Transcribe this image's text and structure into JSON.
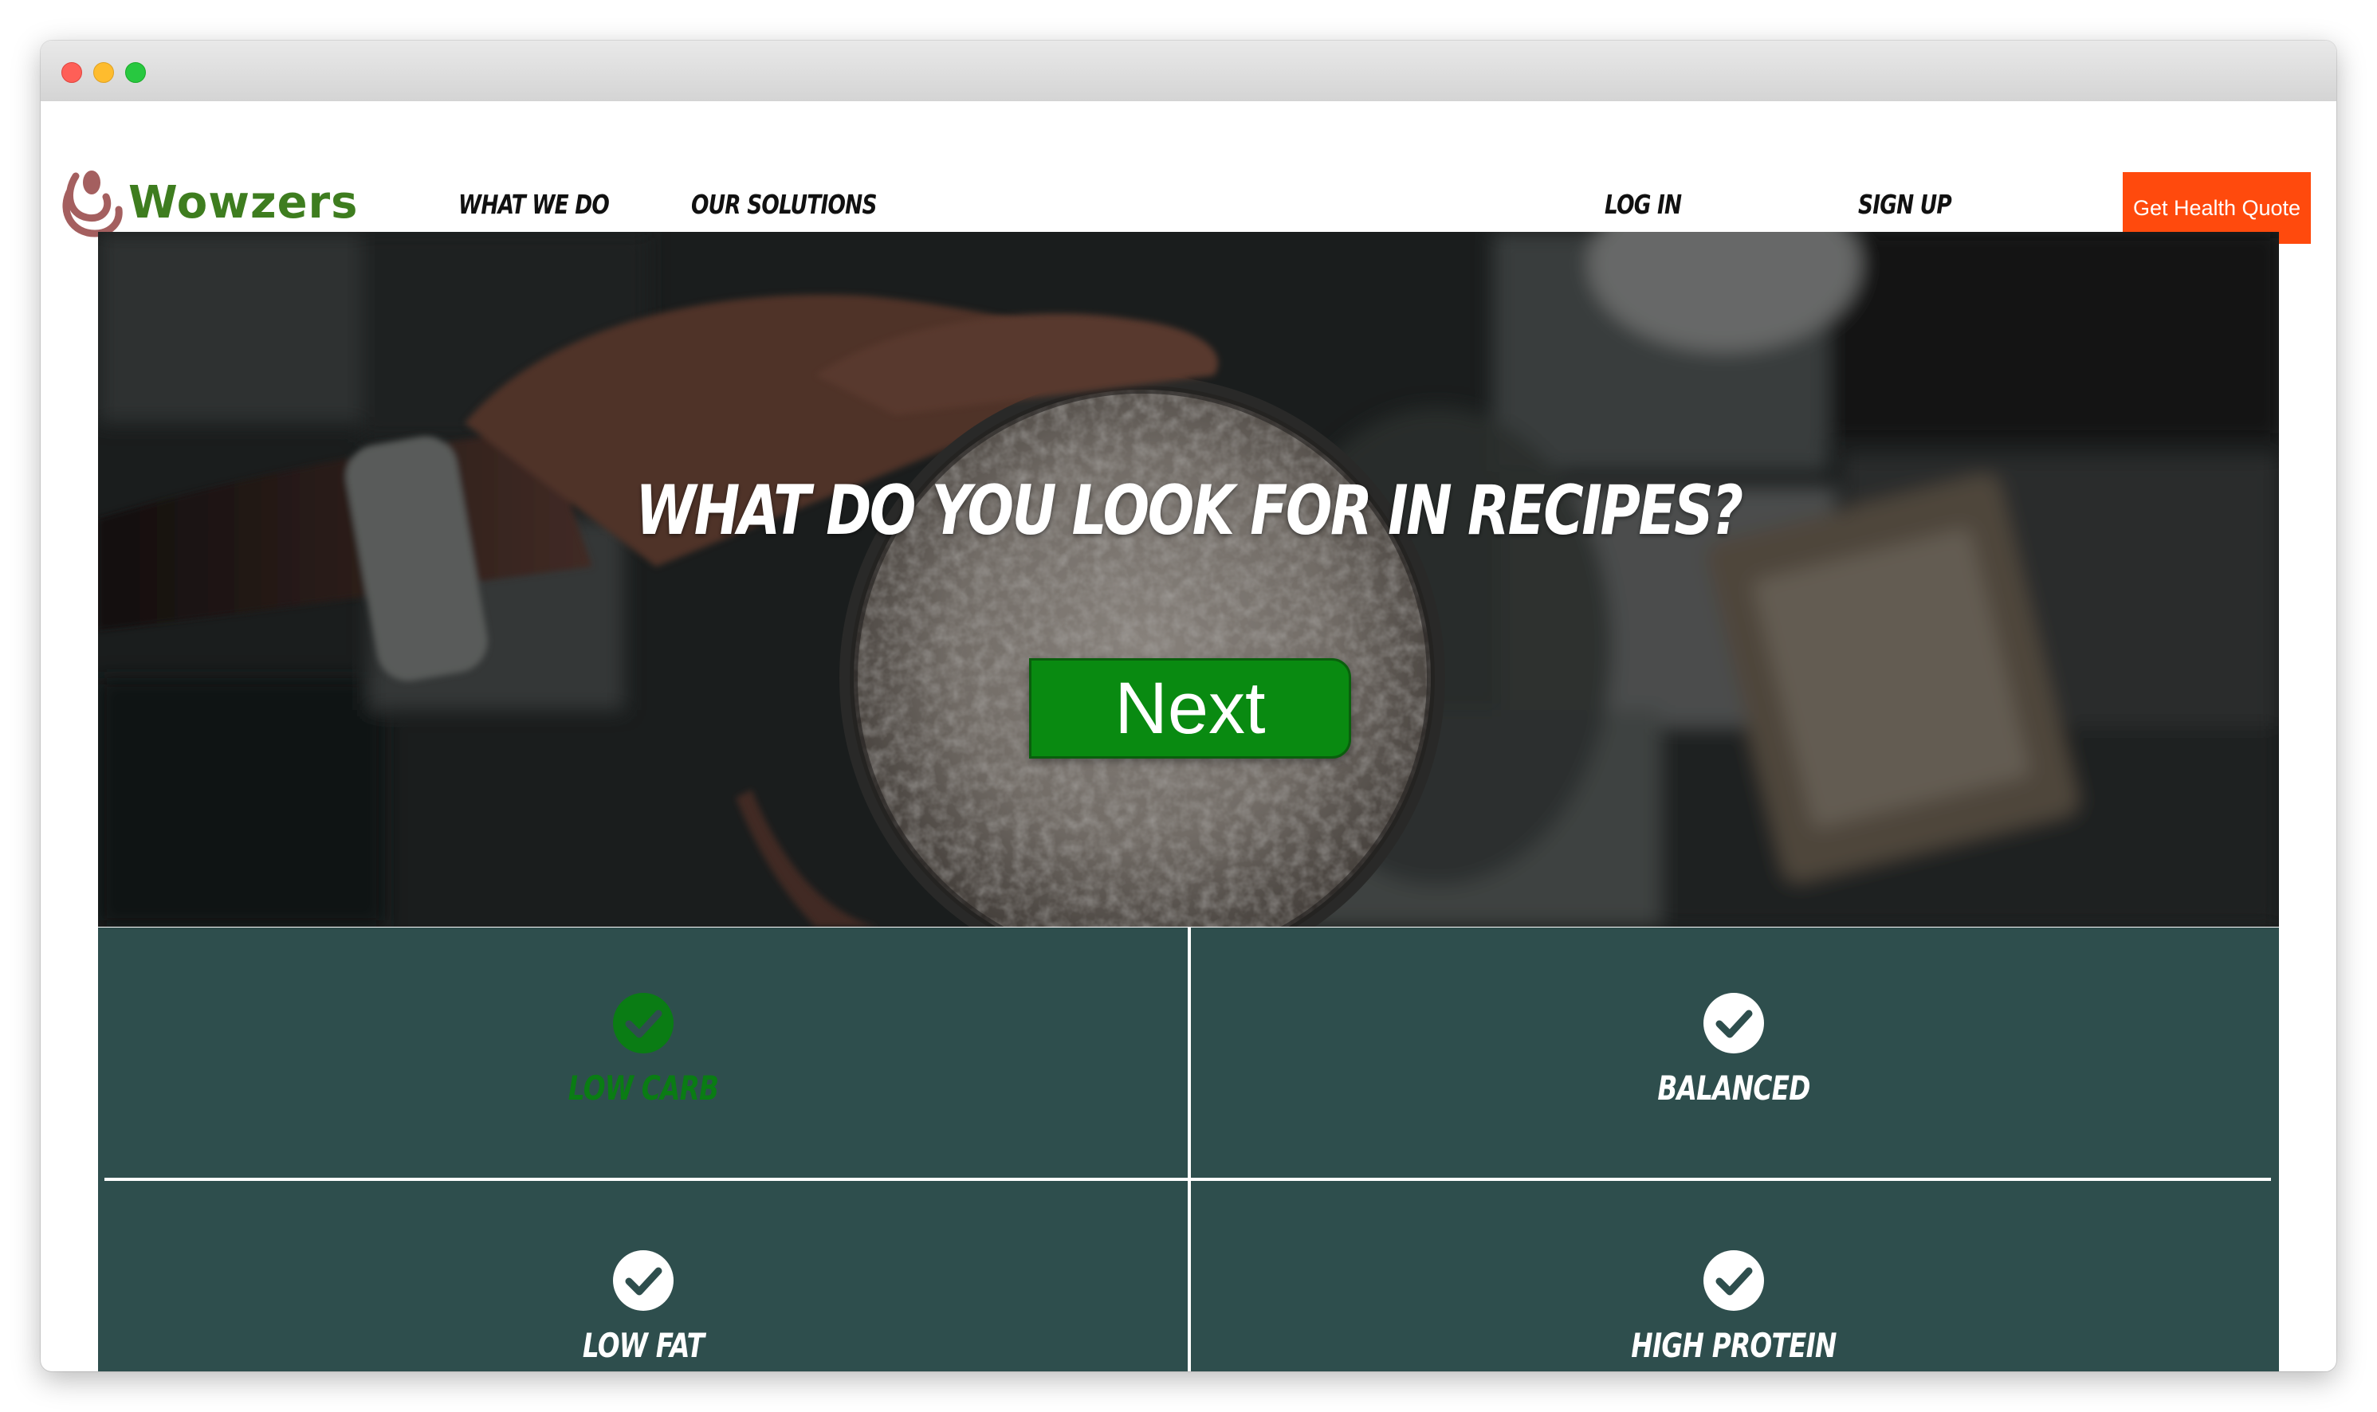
{
  "brand": {
    "name": "Wowzers",
    "logo_colors": [
      "#a45f5f",
      "#3e7d1f"
    ]
  },
  "nav": {
    "items": [
      {
        "label": "WHAT WE DO"
      },
      {
        "label": "OUR SOLUTIONS"
      },
      {
        "label": "LOG IN"
      },
      {
        "label": "SIGN UP"
      }
    ],
    "cta_label": "Get Health Quote",
    "cta_color": "#ff4a0d"
  },
  "hero": {
    "title": "WHAT DO YOU LOOK FOR IN RECIPES?",
    "next_label": "Next",
    "next_color": "#098a11"
  },
  "options": {
    "panel_color": "#2e4e4d",
    "items": [
      {
        "label": "LOW CARB",
        "selected": true,
        "icon": "check-circle-icon"
      },
      {
        "label": "BALANCED",
        "selected": false,
        "icon": "check-circle-icon"
      },
      {
        "label": "LOW FAT",
        "selected": false,
        "icon": "check-circle-icon"
      },
      {
        "label": "HIGH PROTEIN",
        "selected": false,
        "icon": "check-circle-icon"
      }
    ],
    "selected_color": "#0a7c14"
  }
}
